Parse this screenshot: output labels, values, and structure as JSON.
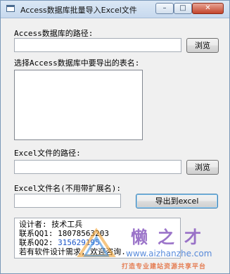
{
  "window": {
    "title": "Access数据库批量导入Excel文件",
    "controls": {
      "minimize": "–",
      "maximize": "□",
      "close": "✕"
    }
  },
  "access_path": {
    "label": "Access数据库的路径:",
    "value": "",
    "browse_label": "浏览"
  },
  "table_select": {
    "label": "选择Access数据库中要导出的表名:",
    "items": []
  },
  "excel_path": {
    "label": "Excel文件的路径:",
    "value": "",
    "browse_label": "浏览"
  },
  "excel_name": {
    "label": "Excel文件名(不用带扩展名):",
    "value": "",
    "export_label": "导出到excel"
  },
  "info": {
    "designer": "设计者: 技术工兵",
    "qq1": "联系QQ1: 18078563203",
    "qq2_prefix": "联系QQ2: ",
    "qq2_value": "315629195",
    "note": "若有软件设计需求, 欢迎咨询."
  },
  "watermark": {
    "name": "懒之才",
    "url": "www.aizhanzhe.com",
    "slogan": "打造专业建站资源共享平台"
  }
}
